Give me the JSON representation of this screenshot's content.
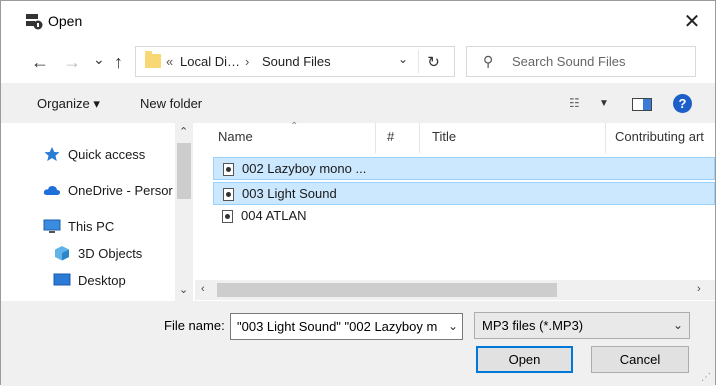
{
  "window": {
    "title": "Open",
    "close_icon": "✕"
  },
  "nav": {
    "back": "←",
    "forward": "→",
    "recent": "⌄",
    "up": "↑",
    "breadcrumb": [
      "«",
      "Local Di…",
      "›",
      "Sound Files"
    ],
    "search_placeholder": "Search Sound Files"
  },
  "toolbar": {
    "organize": "Organize ▾",
    "new_folder": "New folder",
    "help": "?"
  },
  "sidebar": {
    "items": [
      {
        "label": "Quick access",
        "icon": "star-icon"
      },
      {
        "label": "OneDrive - Persor",
        "icon": "cloud-icon"
      },
      {
        "label": "This PC",
        "icon": "computer-icon"
      },
      {
        "label": "3D Objects",
        "icon": "cube-icon"
      },
      {
        "label": "Desktop",
        "icon": "desktop-icon"
      }
    ]
  },
  "columns": {
    "name": "Name",
    "number": "#",
    "title": "Title",
    "contributing": "Contributing art"
  },
  "files": [
    {
      "name": "002 Lazyboy mono ...",
      "selected": true
    },
    {
      "name": "003 Light Sound",
      "selected": true
    },
    {
      "name": "004 ATLAN",
      "selected": false
    }
  ],
  "bottom": {
    "file_name_label": "File name:",
    "file_name_value": "\"003 Light Sound\" \"002 Lazyboy m",
    "file_type": "MP3 files (*.MP3)",
    "open_label": "Open",
    "cancel_label": "Cancel"
  },
  "colors": {
    "selection": "#cce8ff",
    "accent": "#0078d7"
  }
}
